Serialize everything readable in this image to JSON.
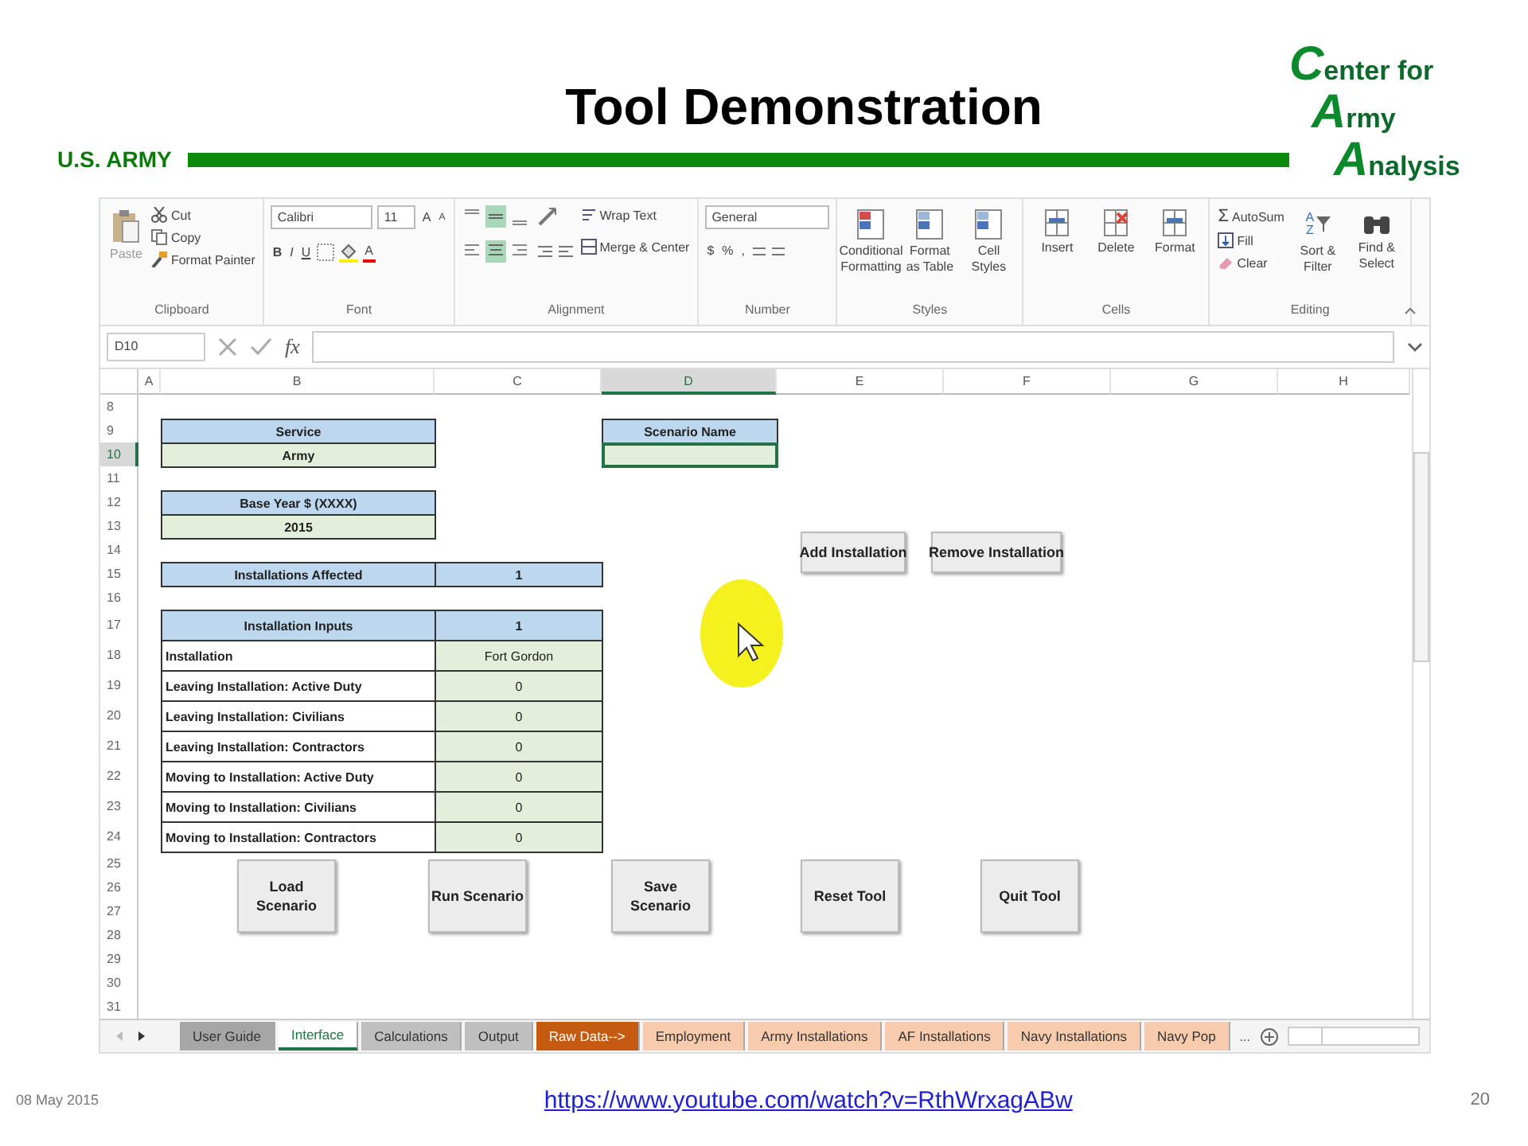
{
  "slide": {
    "title": "Tool Demonstration",
    "org_label": "U.S. ARMY",
    "logo": [
      {
        "initial": "C",
        "rest": "enter for"
      },
      {
        "initial": "A",
        "rest": "rmy"
      },
      {
        "initial": "A",
        "rest": "nalysis"
      }
    ]
  },
  "ribbon": {
    "clipboard": {
      "paste": "Paste",
      "cut": "Cut",
      "copy": "Copy",
      "format_painter": "Format Painter",
      "label": "Clipboard"
    },
    "font": {
      "name": "Calibri",
      "size": "11",
      "grow": "A",
      "shrink": "A",
      "bold": "B",
      "italic": "I",
      "underline": "U",
      "font_color": "A",
      "label": "Font"
    },
    "alignment": {
      "wrap": "Wrap Text",
      "merge": "Merge & Center",
      "label": "Alignment"
    },
    "number": {
      "format": "General",
      "currency": "$",
      "percent": "%",
      "comma": ",",
      "label": "Number"
    },
    "styles": {
      "items": [
        "Conditional Formatting",
        "Format as Table",
        "Cell Styles"
      ],
      "label": "Styles"
    },
    "cells": {
      "items": [
        "Insert",
        "Delete",
        "Format"
      ],
      "label": "Cells"
    },
    "editing": {
      "sigma": "Σ",
      "autosum": "AutoSum",
      "fill": "Fill",
      "clear": "Clear",
      "sort_letters": [
        "A",
        "Z"
      ],
      "sort": "Sort & Filter",
      "find": "Find & Select",
      "label": "Editing"
    }
  },
  "formula_bar": {
    "name_box": "D10",
    "fx": "fx"
  },
  "columns": [
    {
      "label": "A",
      "selected": false
    },
    {
      "label": "B",
      "selected": false
    },
    {
      "label": "C",
      "selected": false
    },
    {
      "label": "D",
      "selected": true
    },
    {
      "label": "E",
      "selected": false
    },
    {
      "label": "F",
      "selected": false
    },
    {
      "label": "G",
      "selected": false
    },
    {
      "label": "H",
      "selected": false
    }
  ],
  "rows": [
    {
      "label": "8",
      "selected": false
    },
    {
      "label": "9",
      "selected": false
    },
    {
      "label": "10",
      "selected": true
    },
    {
      "label": "11",
      "selected": false
    },
    {
      "label": "12",
      "selected": false
    },
    {
      "label": "13",
      "selected": false
    },
    {
      "label": "14",
      "selected": false
    },
    {
      "label": "15",
      "selected": false
    },
    {
      "label": "16",
      "selected": false
    },
    {
      "label": "17",
      "selected": false
    },
    {
      "label": "18",
      "selected": false
    },
    {
      "label": "19",
      "selected": false
    },
    {
      "label": "20",
      "selected": false
    },
    {
      "label": "21",
      "selected": false
    },
    {
      "label": "22",
      "selected": false
    },
    {
      "label": "23",
      "selected": false
    },
    {
      "label": "24",
      "selected": false
    },
    {
      "label": "25",
      "selected": false
    },
    {
      "label": "26",
      "selected": false
    },
    {
      "label": "27",
      "selected": false
    },
    {
      "label": "28",
      "selected": false
    },
    {
      "label": "29",
      "selected": false
    },
    {
      "label": "30",
      "selected": false
    },
    {
      "label": "31",
      "selected": false
    }
  ],
  "service": {
    "header": "Service",
    "value": "Army"
  },
  "base_year": {
    "header": "Base Year $ (XXXX)",
    "value": "2015"
  },
  "scenario_name": {
    "header": "Scenario Name",
    "selected": true
  },
  "installations_affected": {
    "label": "Installations Affected",
    "value": "1"
  },
  "installation_inputs": {
    "header": "Installation Inputs",
    "header_value": "1",
    "rows": [
      {
        "label": "Installation",
        "value": "Fort Gordon"
      },
      {
        "label": "Leaving Installation: Active Duty",
        "value": "0"
      },
      {
        "label": "Leaving Installation: Civilians",
        "value": "0"
      },
      {
        "label": "Leaving Installation: Contractors",
        "value": "0"
      },
      {
        "label": "Moving to Installation: Active Duty",
        "value": "0"
      },
      {
        "label": "Moving to Installation: Civilians",
        "value": "0"
      },
      {
        "label": "Moving to Installation: Contractors",
        "value": "0"
      }
    ]
  },
  "buttons": [
    {
      "kind": "top",
      "lines": [
        "Add Installation"
      ]
    },
    {
      "kind": "top",
      "lines": [
        "Remove Installation"
      ]
    },
    {
      "kind": "bottom",
      "lines": [
        "Load",
        "Scenario"
      ]
    },
    {
      "kind": "bottom",
      "lines": [
        "Run Scenario"
      ]
    },
    {
      "kind": "bottom",
      "lines": [
        "Save",
        "Scenario"
      ]
    },
    {
      "kind": "bottom",
      "lines": [
        "Reset Tool"
      ]
    },
    {
      "kind": "bottom",
      "lines": [
        "Quit Tool"
      ]
    }
  ],
  "sheet_tabs": [
    {
      "label": "User Guide",
      "selected": false,
      "color": "#a6a6a6"
    },
    {
      "label": "Interface",
      "selected": true,
      "color": "#ffffff"
    },
    {
      "label": "Calculations",
      "selected": false,
      "color": "#bfbfbf"
    },
    {
      "label": "Output",
      "selected": false,
      "color": "#bfbfbf"
    },
    {
      "label": "Raw Data-->",
      "selected": false,
      "color": "#c55a11"
    },
    {
      "label": "Employment",
      "selected": false,
      "color": "#f8cbad"
    },
    {
      "label": "Army Installations",
      "selected": false,
      "color": "#f8cbad"
    },
    {
      "label": "AF Installations",
      "selected": false,
      "color": "#f8cbad"
    },
    {
      "label": "Navy Installations",
      "selected": false,
      "color": "#f8cbad"
    },
    {
      "label": "Navy Pop",
      "selected": false,
      "color": "#f8cbad"
    }
  ],
  "more_tabs": "...",
  "footer": {
    "date": "08 May 2015",
    "link": "https://www.youtube.com/watch?v=RthWrxagABw",
    "page": "20"
  }
}
